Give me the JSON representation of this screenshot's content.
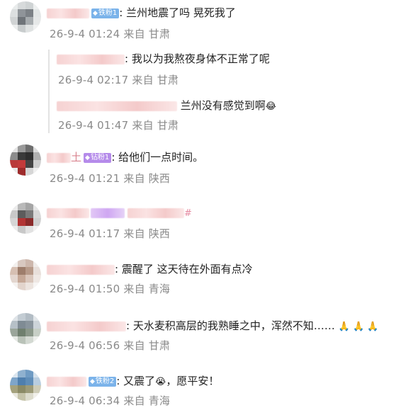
{
  "comments": [
    {
      "badge": "铁粉1",
      "text": "兰州地震了吗 晃死我了",
      "meta": "26-9-4 01:24 来自 甘肃",
      "replies": [
        {
          "text": "我以为我熬夜身体不正常了呢",
          "meta": "26-9-4 02:17 来自 甘肃"
        },
        {
          "text": "兰州没有感觉到啊",
          "meta": "26-9-4 01:47 来自 甘肃"
        }
      ]
    },
    {
      "name_tail": "土",
      "badge": "钻粉1",
      "text": "给他们一点时间。",
      "meta": "26-9-4 01:21 来自 陕西"
    },
    {
      "tag": "#",
      "meta": "26-9-4 01:17 来自 陕西"
    },
    {
      "text": "震醒了 这天待在外面有点冷",
      "meta": "26-9-4 01:50 来自 青海"
    },
    {
      "text": "天水麦积高层的我熟睡之中，浑然不知……",
      "emojis": "🙏 🙏 🙏",
      "meta": "26-9-4 06:56 来自 甘肃"
    },
    {
      "badge": "铁粉2",
      "text_a": "又震了",
      "emoji": "😭",
      "text_b": "，愿平安！",
      "meta": "26-9-4 06:34 来自 青海"
    }
  ],
  "icons": {
    "badge_gem": "diamond-icon",
    "laugh_emoji": "😂"
  },
  "colors": {
    "meta": "#8a8a8a",
    "iron_badge": "#7bb3ea",
    "drill_badge": "#b58bea"
  }
}
